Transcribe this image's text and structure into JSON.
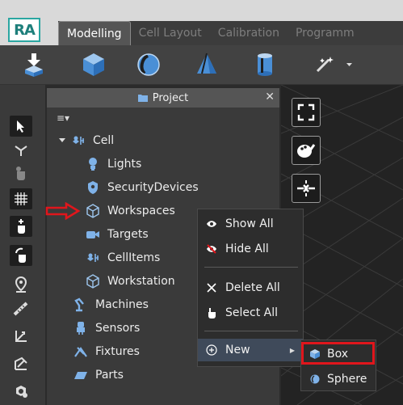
{
  "app": {
    "logo_text": "RA",
    "accent_color": "#2aa6a1",
    "highlight_color": "#e0161c"
  },
  "tabs": [
    {
      "label": "Modelling",
      "active": true
    },
    {
      "label": "Cell Layout",
      "active": false
    },
    {
      "label": "Calibration",
      "active": false
    },
    {
      "label": "Programm",
      "active": false
    }
  ],
  "ribbon": {
    "tools": [
      "import-icon",
      "cube-icon",
      "sphere-icon",
      "cone-icon",
      "cylinder-icon",
      "magic-wand-icon"
    ]
  },
  "left_toolbar": {
    "tools": [
      "select-arrow-icon",
      "lasso-icon",
      "grab-icon",
      "grid-icon",
      "move-hand-icon",
      "rotate-hand-icon",
      "location-pin-icon",
      "ruler-icon",
      "axes-icon",
      "scale-icon",
      "settings-cube-icon"
    ]
  },
  "project_panel": {
    "title": "Project",
    "close_label": "✕",
    "menu_label": "≡▾",
    "tree": [
      {
        "label": "Cell",
        "icon": "cell-icon",
        "level": 0
      },
      {
        "label": "Lights",
        "icon": "bulb-icon",
        "level": 1
      },
      {
        "label": "SecurityDevices",
        "icon": "shield-icon",
        "level": 1
      },
      {
        "label": "Workspaces",
        "icon": "cube-outline-icon",
        "level": 1
      },
      {
        "label": "Targets",
        "icon": "camera-icon",
        "level": 1
      },
      {
        "label": "CellItems",
        "icon": "cell-icon",
        "level": 1
      },
      {
        "label": "Workstation",
        "icon": "cube-outline-icon",
        "level": 1
      },
      {
        "label": "Machines",
        "icon": "robot-arm-icon",
        "level": 0
      },
      {
        "label": "Sensors",
        "icon": "sensor-icon",
        "level": 0
      },
      {
        "label": "Fixtures",
        "icon": "fixture-icon",
        "level": 0
      },
      {
        "label": "Parts",
        "icon": "part-icon",
        "level": 0
      }
    ]
  },
  "viewport_tools": [
    "fullscreen-icon",
    "paint-icon",
    "collapse-icon"
  ],
  "context_menu": {
    "items": [
      {
        "label": "Show All",
        "icon": "eye-icon"
      },
      {
        "label": "Hide All",
        "icon": "eye-off-icon"
      },
      {
        "label": "Delete All",
        "icon": "x-icon"
      },
      {
        "label": "Select All",
        "icon": "hand-icon"
      },
      {
        "label": "New",
        "icon": "plus-circle-icon",
        "has_submenu": true
      }
    ]
  },
  "submenu": {
    "items": [
      {
        "label": "Box",
        "icon": "box-icon",
        "highlighted": true
      },
      {
        "label": "Sphere",
        "icon": "sphere-small-icon"
      }
    ]
  }
}
